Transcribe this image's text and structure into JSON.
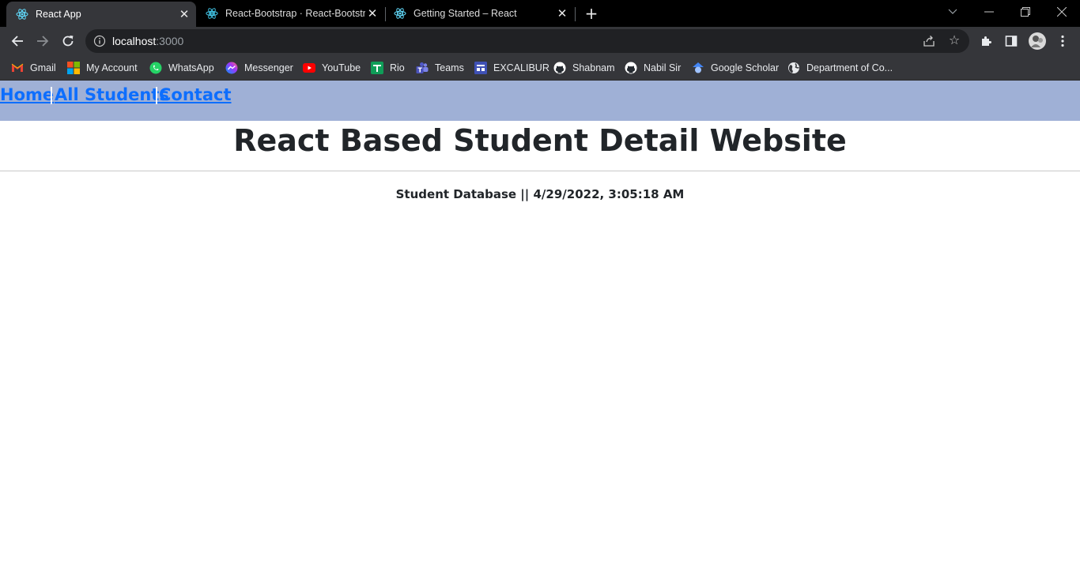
{
  "browser": {
    "tabs": [
      {
        "title": "React App",
        "active": true
      },
      {
        "title": "React-Bootstrap · React-Bootstrap",
        "active": false
      },
      {
        "title": "Getting Started – React",
        "active": false
      }
    ],
    "address": {
      "host": "localhost",
      "port": ":3000"
    },
    "bookmarks": [
      {
        "label": "Gmail"
      },
      {
        "label": "My Account"
      },
      {
        "label": "WhatsApp"
      },
      {
        "label": "Messenger"
      },
      {
        "label": "YouTube"
      },
      {
        "label": "Rio"
      },
      {
        "label": "Teams"
      },
      {
        "label": "EXCALIBUR"
      },
      {
        "label": "Shabnam"
      },
      {
        "label": "Nabil Sir"
      },
      {
        "label": "Google Scholar"
      },
      {
        "label": "Department of Co..."
      }
    ]
  },
  "nav": {
    "links": [
      "Home",
      "All Students",
      "Contact"
    ]
  },
  "main": {
    "title": "React Based Student Detail Website",
    "subtitle": "Student Database || 4/29/2022, 3:05:18 AM"
  },
  "colors": {
    "nav_background": "#9fb0d6",
    "link": "#0d6efd",
    "text": "#212529"
  }
}
